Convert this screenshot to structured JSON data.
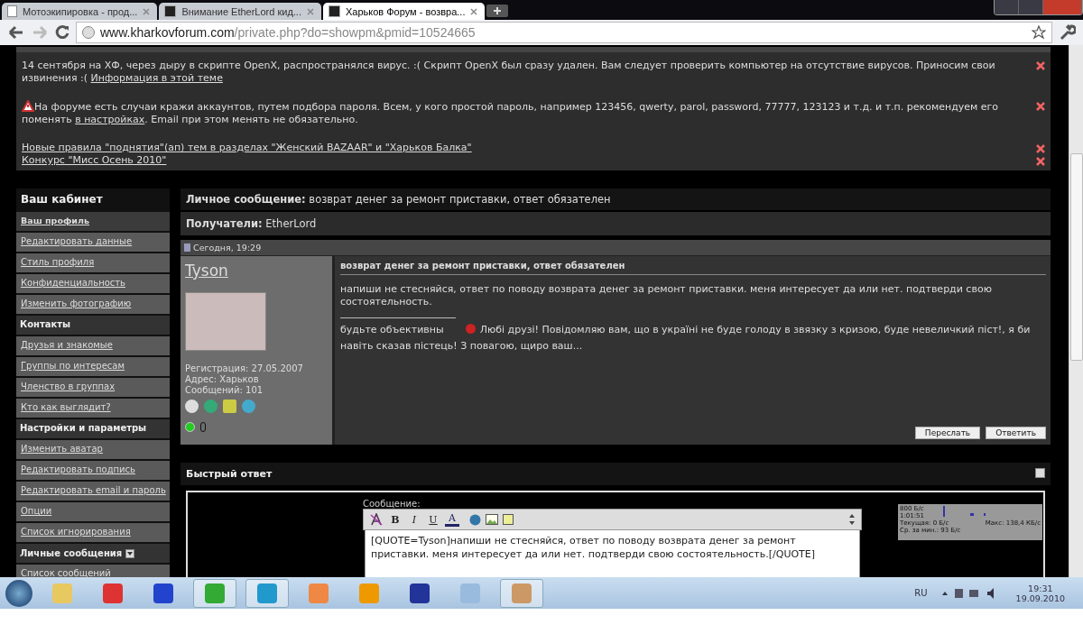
{
  "browser": {
    "tabs": [
      {
        "title": "Мотоэкипировка - прод...",
        "selected": false,
        "kind": "page"
      },
      {
        "title": "Внимание EtherLord кид...",
        "selected": false,
        "kind": "forum"
      },
      {
        "title": "Харьков Форум - возвра...",
        "selected": true,
        "kind": "forum"
      }
    ],
    "url_host": "www.kharkovforum.com",
    "url_path": "/private.php?do=showpm&pmid=10524665"
  },
  "notices": [
    {
      "text": "14 сентября на ХФ, через дыру в скрипте OpenX, распространялся вирус. :( Скрипт OpenX был сразу удален. Вам следует проверить компьютер на отсутствие вирусов. Приносим свои извинения :( ",
      "link": "Информация в этой теме",
      "warning": false
    },
    {
      "text": "На форуме есть случаи кражи аккаунтов, путем подбора пароля. Всем, у кого простой пароль, например 123456, qwerty, parol, password, 77777, 123123 и т.д. и т.п. рекомендуем его поменять ",
      "link": "в настройках",
      "after": ". Email при этом менять не обязательно.",
      "warning": true
    }
  ],
  "notice_links": [
    "Новые правила \"поднятия\"(ап) тем в разделах \"Женский BAZAAR\" и \"Харьков Балка\"",
    "Конкурс \"Мисс Осень 2010\""
  ],
  "sidebar": {
    "title": "Ваш кабинет",
    "items": [
      {
        "kind": "current",
        "label": "Ваш профиль"
      },
      {
        "kind": "link",
        "label": "Редактировать данные"
      },
      {
        "kind": "link",
        "label": "Стиль профиля"
      },
      {
        "kind": "link",
        "label": "Конфиденциальность"
      },
      {
        "kind": "link",
        "label": "Изменить фотографию"
      },
      {
        "kind": "header",
        "label": "Контакты"
      },
      {
        "kind": "link",
        "label": "Друзья и знакомые"
      },
      {
        "kind": "link",
        "label": "Группы по интересам"
      },
      {
        "kind": "link",
        "label": "Членство в группах"
      },
      {
        "kind": "link",
        "label": "Кто как выглядит?"
      },
      {
        "kind": "header",
        "label": "Настройки и параметры"
      },
      {
        "kind": "link",
        "label": "Изменить аватар"
      },
      {
        "kind": "link",
        "label": "Редактировать подпись"
      },
      {
        "kind": "link",
        "label": "Редактировать email и пароль"
      },
      {
        "kind": "link",
        "label": "Опции"
      },
      {
        "kind": "link",
        "label": "Список игнорирования"
      },
      {
        "kind": "header-collapsible",
        "label": "Личные сообщения"
      },
      {
        "kind": "link",
        "label": "Список сообщений"
      }
    ]
  },
  "message": {
    "title": "**Личное сообщение:** возврат денег за ремонт приставки, ответ обязателен",
    "recipients": "**Получатели:** EtherLord",
    "date": "Сегодня, 19:29",
    "author": {
      "name": "Tyson",
      "stats": [
        "Регистрация: 27.05.2007",
        "Адрес: Харьков",
        "Сообщений: 101"
      ],
      "online": true
    },
    "subject": "возврат денег за ремонт приставки, ответ обязателен",
    "body": "напиши не стесняйся, ответ по поводу возврата денег за ремонт приставки. меня интересует да или нет. подтверди свою состоятельность.",
    "signature_before": "будьте объективны",
    "signature": "Любі друзі! Повідомляю вам, що в україні не буде голоду в звязку з кризою, буде невеличкий піст!, я би навіть сказав пістець! З повагою, щиро ваш...",
    "buttons": [
      "Переслать",
      "Ответить"
    ]
  },
  "quick_reply": {
    "title": "Быстрый ответ",
    "label": "Сообщение:",
    "format_buttons": [
      {
        "kind": "bold",
        "label": "B"
      },
      {
        "kind": "italic",
        "label": "I"
      },
      {
        "kind": "underline",
        "label": "U"
      },
      {
        "kind": "color",
        "label": "A"
      }
    ],
    "value": "[QUOTE=Tyson]напиши не стесняйся, ответ по поводу возврата денег за ремонт приставки. меня интересует да или нет. подтверди свою состоятельность.[/QUOTE]"
  },
  "net_monitor": {
    "scale": "800 Б/с",
    "time": "1:01:51",
    "current": "Текущая: 0 Б/с",
    "max": "Макс: 138,4 КБ/с",
    "average": "Ср. за мин.: 93 Б/с"
  },
  "taskbar": {
    "language": "RU",
    "time": "19:31",
    "date": "19.09.2010"
  }
}
